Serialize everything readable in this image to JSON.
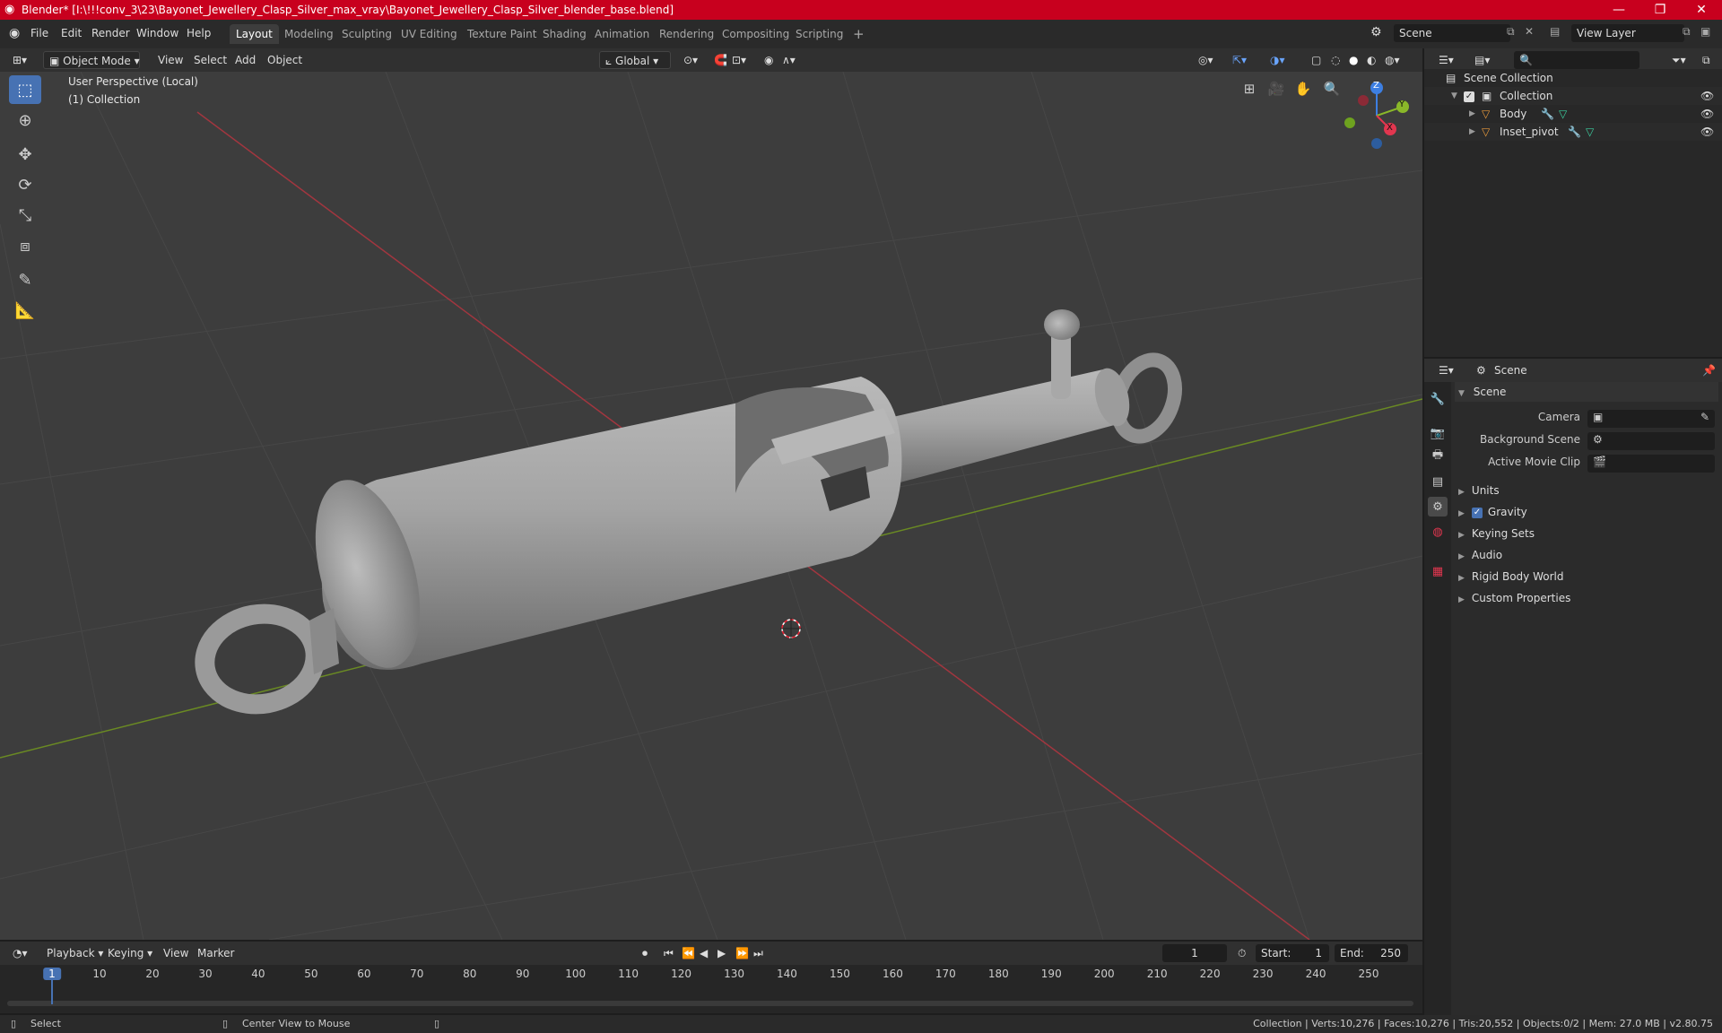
{
  "window": {
    "title": "Blender* [I:\\!!!conv_3\\23\\Bayonet_Jewellery_Clasp_Silver_max_vray\\Bayonet_Jewellery_Clasp_Silver_blender_base.blend]"
  },
  "menus": [
    "File",
    "Edit",
    "Render",
    "Window",
    "Help"
  ],
  "workspaces": [
    "Layout",
    "Modeling",
    "Sculpting",
    "UV Editing",
    "Texture Paint",
    "Shading",
    "Animation",
    "Rendering",
    "Compositing",
    "Scripting"
  ],
  "scene_field": "Scene",
  "view_layer_field": "View Layer",
  "viewport_header": {
    "mode": "Object Mode",
    "view": "View",
    "select": "Select",
    "add": "Add",
    "object": "Object",
    "orientation": "Global"
  },
  "viewport": {
    "perspective": "User Perspective (Local)",
    "collection": "(1) Collection"
  },
  "gizmo": {
    "x": "X",
    "y": "Y",
    "z": "Z"
  },
  "outliner": {
    "root": "Scene Collection",
    "collection": "Collection",
    "items": [
      "Body",
      "Inset_pivot"
    ]
  },
  "properties": {
    "header": "Scene",
    "panel": "Scene",
    "camera": "Camera",
    "background_scene": "Background Scene",
    "active_movie_clip": "Active Movie Clip",
    "sections": [
      "Units",
      "Gravity",
      "Keying Sets",
      "Audio",
      "Rigid Body World",
      "Custom Properties"
    ]
  },
  "timeline": {
    "playback": "Playback",
    "keying": "Keying",
    "view": "View",
    "marker": "Marker",
    "current_frame": "1",
    "start_label": "Start:",
    "start": "1",
    "end_label": "End:",
    "end": "250",
    "ticks": [
      "1",
      "10",
      "20",
      "30",
      "40",
      "50",
      "60",
      "70",
      "80",
      "90",
      "100",
      "110",
      "120",
      "130",
      "140",
      "150",
      "160",
      "170",
      "180",
      "190",
      "200",
      "210",
      "220",
      "230",
      "240",
      "250"
    ]
  },
  "status": {
    "select": "Select",
    "center": "Center View to Mouse",
    "stats": "Collection | Verts:10,276 | Faces:10,276 | Tris:20,552 | Objects:0/2 | Mem: 27.0 MB | v2.80.75"
  },
  "colors": {
    "accent": "#4772b3",
    "titlebar": "#c8001e",
    "x_axis": "#e2364f",
    "y_axis": "#8ab829",
    "z_axis": "#3d7fe2"
  }
}
